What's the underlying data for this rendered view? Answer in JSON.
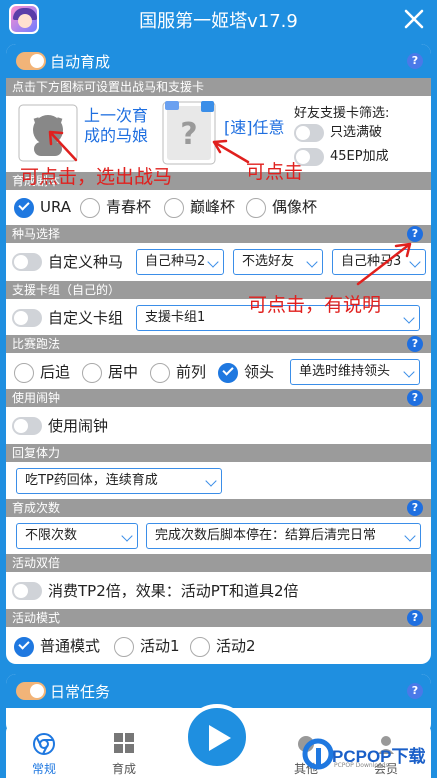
{
  "app": {
    "title": "国服第一姬塔v17.9",
    "close_icon": "close-icon"
  },
  "auto_train": {
    "header": "自动育成",
    "enabled": true,
    "support_hint": "点击下方图标可设置出战马和支援卡",
    "last_horse_label": "上一次育成的马娘",
    "last_horse_line1": "上一次育",
    "last_horse_line2": "成的马娘",
    "speed_label": "[速]任意",
    "friend_filter_title": "好友支援卡筛选:",
    "only_max_break": "只选满破",
    "ep45_bonus": "45EP加成",
    "mode_section": "育成剧本",
    "modes": [
      "URA",
      "青春杯",
      "巅峰杯",
      "偶像杯"
    ],
    "mode_selected": 0,
    "horse_section": "种马选择",
    "custom_horse": "自定义种马",
    "horse_select_1": "自己种马2",
    "horse_select_2": "不选好友",
    "horse_select_3": "自己种马3",
    "card_section": "支援卡组（自己的）",
    "custom_card": "自定义卡组",
    "card_select": "支援卡组1",
    "race_section": "比赛跑法",
    "race_styles": [
      "后追",
      "居中",
      "前列",
      "领头"
    ],
    "race_selected": 3,
    "race_select": "单选时维持领头",
    "alarm_section": "使用闹钟",
    "use_alarm": "使用闹钟",
    "stamina_section": "回复体力",
    "stamina_select": "吃TP药回体，连续育成",
    "times_section": "育成次数",
    "times_select": "不限次数",
    "after_select": "完成次数后脚本停在：结算后清完日常",
    "double_section": "活动双倍",
    "double_option": "消费TP2倍，效果：活动PT和道具2倍",
    "event_section": "活动模式",
    "event_modes": [
      "普通模式",
      "活动1",
      "活动2"
    ],
    "event_selected": 0
  },
  "daily": {
    "header": "日常任务",
    "enabled": true
  },
  "annotations": {
    "click_select_horse": "可点击，选出战马",
    "clickable": "可点击",
    "clickable_help": "可点击，有说明"
  },
  "bottom_nav": {
    "items": [
      {
        "label": "常规",
        "icon": "chrome-icon"
      },
      {
        "label": "育成",
        "icon": "grid-icon"
      },
      {
        "label": "其他",
        "icon": "other-icon"
      },
      {
        "label": "会员",
        "icon": "member-icon"
      }
    ],
    "play_icon": "play-icon"
  },
  "watermark": {
    "brand": "PCPOP下载",
    "sub": "PCPOP Downloads"
  },
  "colors": {
    "primary": "#1f8fe0",
    "section_bg": "#9b9b9b",
    "annotation": "#e0201e",
    "toggle_on": "#f2b478"
  }
}
